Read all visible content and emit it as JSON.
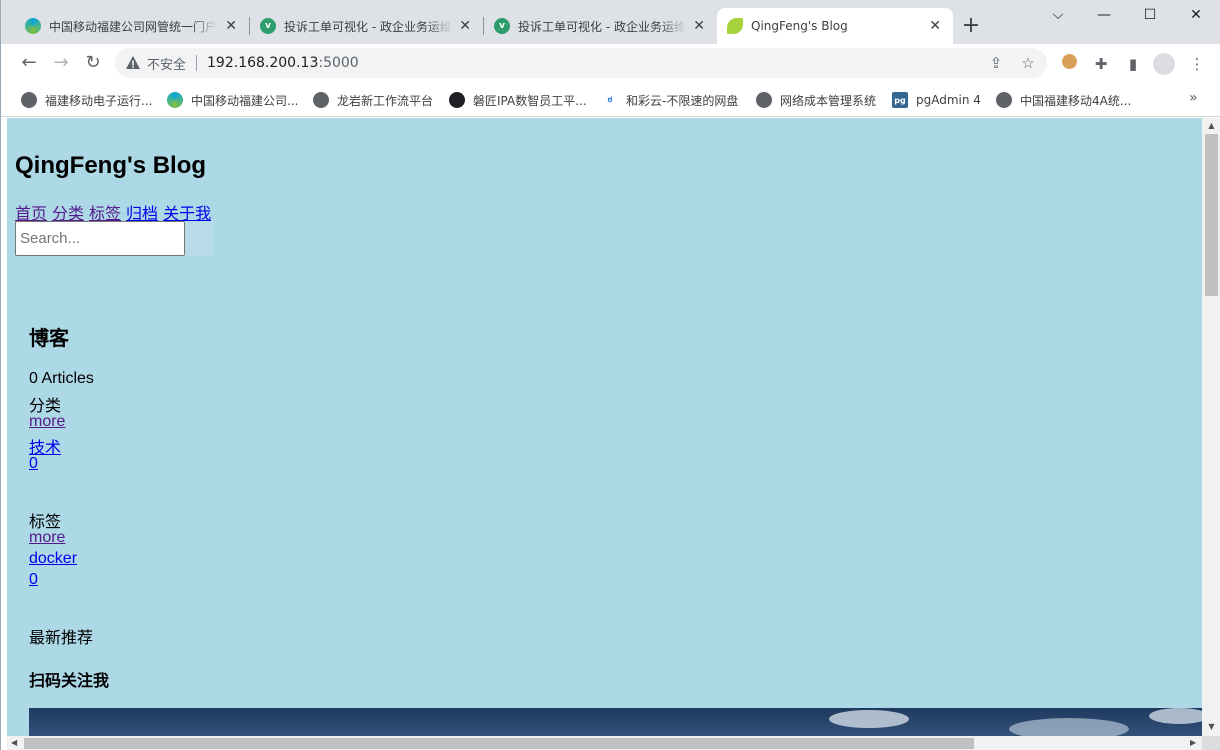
{
  "browser": {
    "tabs": [
      {
        "title": "中国移动福建公司网管统一门户",
        "icon": "china-mobile-icon",
        "active": false
      },
      {
        "title": "投诉工单可视化 - 政企业务运维",
        "icon": "vue-icon",
        "active": false
      },
      {
        "title": "投诉工单可视化 - 政企业务运维",
        "icon": "vue-icon",
        "active": false
      },
      {
        "title": "QingFeng's Blog",
        "icon": "leaf-icon",
        "active": true
      }
    ],
    "new_tab": "+",
    "window_controls": {
      "dropdown": "⌵",
      "minimize": "—",
      "maximize": "☐",
      "close": "✕"
    },
    "nav": {
      "back": "←",
      "forward": "→",
      "reload": "↻"
    },
    "omnibox": {
      "security_label": "不安全",
      "host": "192.168.200.13",
      "port": ":5000"
    },
    "bookmarks": [
      {
        "label": "福建移动电子运行...",
        "icon": "globe-icon"
      },
      {
        "label": "中国移动福建公司...",
        "icon": "china-mobile-icon"
      },
      {
        "label": "龙岩新工作流平台",
        "icon": "globe-icon"
      },
      {
        "label": "磐匠IPA数智员工平...",
        "icon": "ipa-icon"
      },
      {
        "label": "和彩云-不限速的网盘",
        "icon": "cloud-icon"
      },
      {
        "label": "网络成本管理系统",
        "icon": "globe-icon"
      },
      {
        "label": "pgAdmin 4",
        "icon": "pg-icon"
      },
      {
        "label": "中国福建移动4A统...",
        "icon": "globe-icon"
      }
    ],
    "bookmarks_more": "»",
    "colors": {
      "tabstrip": "#dee1e6",
      "page_bg": "#add8e6",
      "link": "#0000ee",
      "visited": "#551a8b"
    }
  },
  "page": {
    "site_title": "QingFeng's Blog",
    "nav_links": [
      "首页",
      "分类",
      "标签",
      "归档",
      "关于我"
    ],
    "search_placeholder": "Search...",
    "sidebar": {
      "heading": "博客",
      "articles_count": "0",
      "articles_label": "Articles",
      "categories": {
        "label": "分类",
        "more": "more",
        "item": "技术",
        "count": "0"
      },
      "tags": {
        "label": "标签",
        "more": "more",
        "item": "docker",
        "count": "0"
      },
      "recommend_label": "最新推荐",
      "qr_label": "扫码关注我"
    }
  }
}
